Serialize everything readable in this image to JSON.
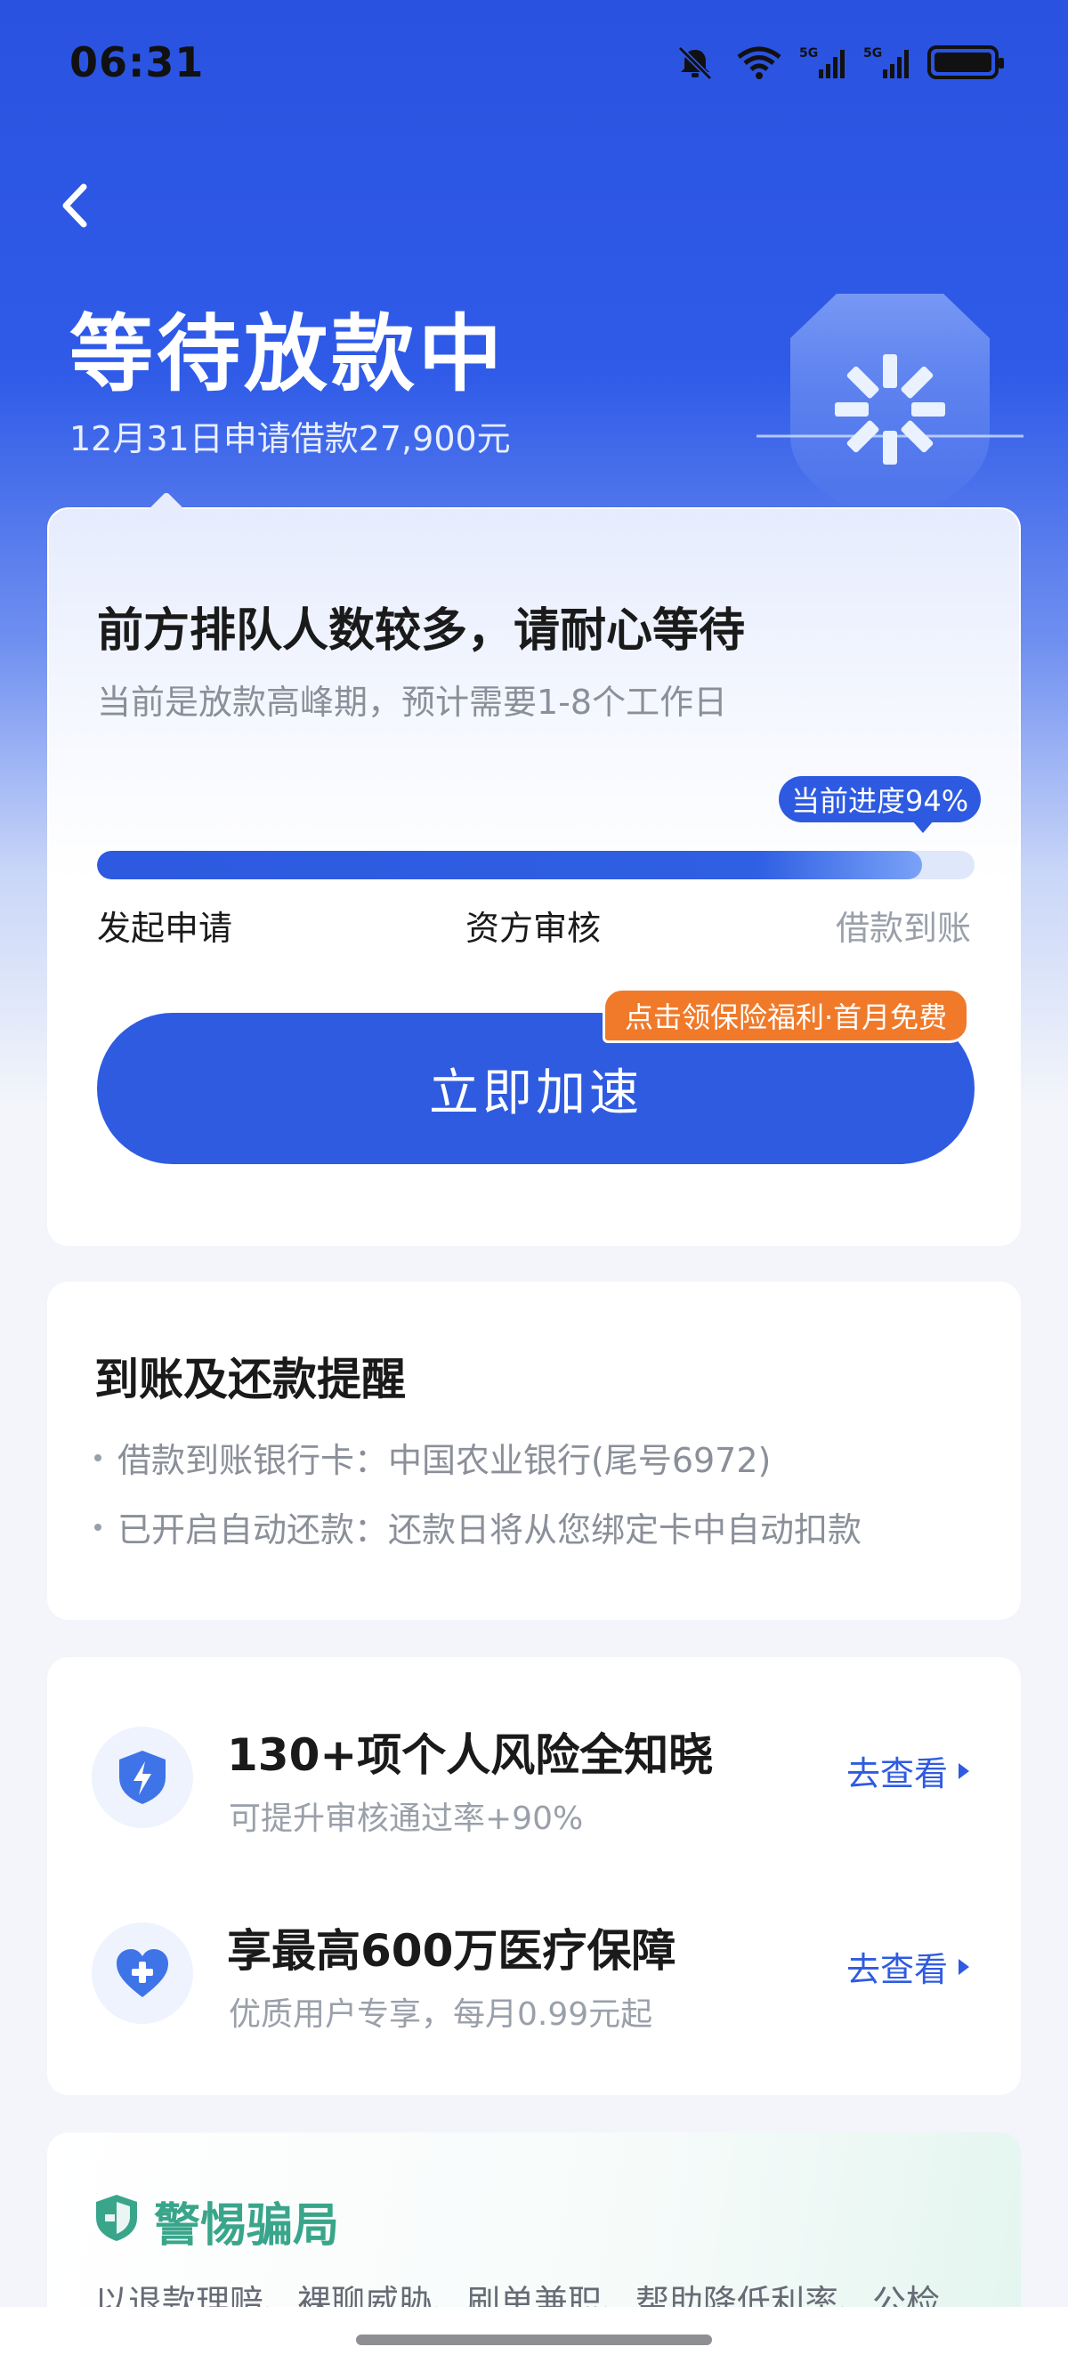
{
  "status_bar": {
    "time": "06:31",
    "network_1": "5G",
    "network_2": "5G"
  },
  "header": {
    "title": "等待放款中",
    "subtitle": "12月31日申请借款27,900元"
  },
  "progress_card": {
    "headline": "前方排队人数较多，请耐心等待",
    "description": "当前是放款高峰期，预计需要1-8个工作日",
    "progress_label": "当前进度94%",
    "progress_value": 0.94,
    "steps": [
      "发起申请",
      "资方审核",
      "借款到账"
    ],
    "promo_tag": "点击领保险福利·首月免费",
    "accelerate_button": "立即加速"
  },
  "reminder_card": {
    "title": "到账及还款提醒",
    "lines": [
      "借款到账银行卡：中国农业银行(尾号6972)",
      "已开启自动还款：还款日将从您绑定卡中自动扣款"
    ]
  },
  "services": [
    {
      "icon": "lightning-shield-icon",
      "title": "130+项个人风险全知晓",
      "subtitle": "可提升审核通过率+90%",
      "link": "去查看"
    },
    {
      "icon": "heart-plus-icon",
      "title": "享最高600万医疗保障",
      "subtitle": "优质用户专享，每月0.99元起",
      "link": "去查看"
    }
  ],
  "warning_card": {
    "title": "警惕骗局",
    "text": "以退款理赔、裸聊威胁、刷单兼职、帮助降低利率、公检"
  },
  "colors": {
    "primary": "#2f5be0",
    "promo": "#f07a2a",
    "warning": "#39a58a"
  }
}
